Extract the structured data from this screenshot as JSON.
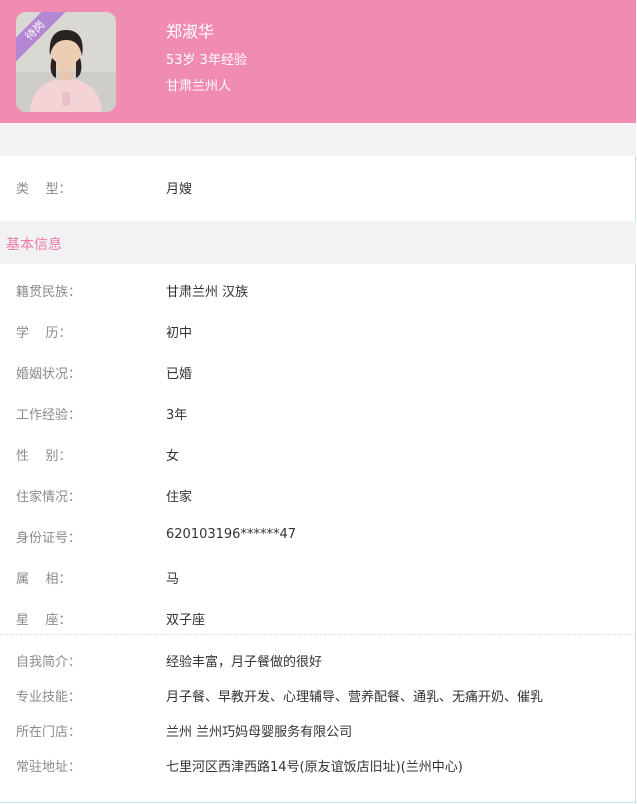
{
  "profile": {
    "badge": "待岗",
    "name": "郑淑华",
    "age_experience": "53岁 3年经验",
    "origin": "甘肃兰州人"
  },
  "type_row": {
    "label": "类    型：",
    "value": "月嫂"
  },
  "section": {
    "title": "基本信息"
  },
  "basic": [
    {
      "label": "籍贯民族：",
      "value": "甘肃兰州 汉族"
    },
    {
      "label": "学    历：",
      "value": "初中"
    },
    {
      "label": "婚姻状况：",
      "value": "已婚"
    },
    {
      "label": "工作经验：",
      "value": "3年"
    },
    {
      "label": "性    别：",
      "value": "女"
    },
    {
      "label": "住家情况：",
      "value": "住家"
    },
    {
      "label": "身份证号：",
      "value": "620103196******47"
    },
    {
      "label": "属    相：",
      "value": "马"
    },
    {
      "label": "星    座：",
      "value": "双子座"
    }
  ],
  "extra": [
    {
      "label": "自我简介：",
      "value": "经验丰富，月子餐做的很好"
    },
    {
      "label": "专业技能：",
      "value": "月子餐、早教开发、心理辅导、营养配餐、通乳、无痛开奶、催乳"
    },
    {
      "label": "所在门店：",
      "value": "兰州 兰州巧妈母婴服务有限公司"
    },
    {
      "label": "常驻地址：",
      "value": "七里河区西津西路14号(原友谊饭店旧址)(兰州中心)"
    }
  ]
}
